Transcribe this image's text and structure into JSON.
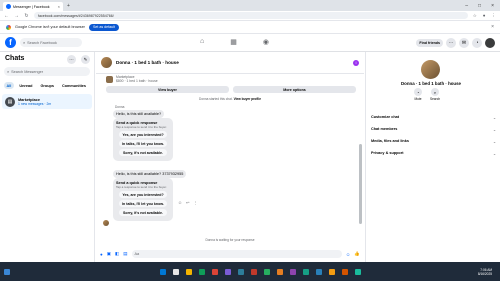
{
  "browser": {
    "tab_title": "Messenger | Facebook",
    "url": "facebook.com/messages/t/2436987922554766/",
    "infobar_message": "Google Chrome isn't your default browser",
    "infobar_button": "Set as default"
  },
  "header": {
    "search_placeholder": "Search Facebook",
    "find_friends": "Find friends"
  },
  "sidebar": {
    "title": "Chats",
    "search_placeholder": "Search Messenger",
    "filters": [
      "All",
      "Unread",
      "Groups",
      "Communities"
    ],
    "chat": {
      "name": "Marketplace",
      "subtitle": "1 new messages · 2m"
    }
  },
  "conversation": {
    "title": "Donna · 1 bed 1 bath · house",
    "listing_label": "Marketplace",
    "listing_detail": "$800 · 1 bed 1 bath · house",
    "view_buyer": "View buyer",
    "more_options": "More options",
    "started_chat": "Donna started this chat.",
    "view_profile": "View buyer profile",
    "sender": "Donna",
    "message1": "Hello, is this still available?",
    "message2": "Hello, is this still available?  3737932955",
    "quick_title": "Send a quick response",
    "quick_sub": "Tap a response to send it to the buyer.",
    "options": [
      "Yes, are you interested?",
      "In talks, I'll let you know.",
      "Sorry, it's not available."
    ],
    "waiting": "Donna is waiting for your response",
    "composer_placeholder": "Aa"
  },
  "right_panel": {
    "title": "Donna · 1 bed 1 bath · house",
    "mute": "Mute",
    "search": "Search",
    "sections": [
      "Customize chat",
      "Chat members",
      "Media, files and links",
      "Privacy & support"
    ]
  },
  "taskbar": {
    "time": "7:06 AM",
    "date": "8/16/2025"
  }
}
